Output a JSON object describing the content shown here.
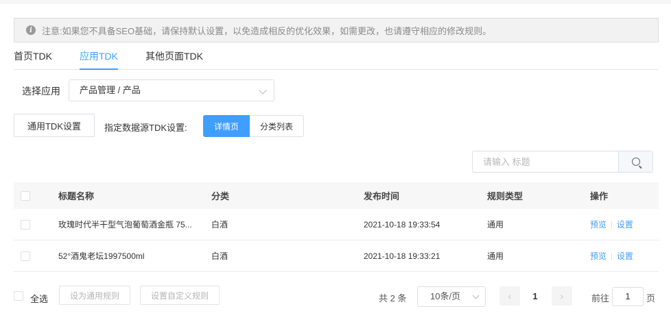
{
  "notice": {
    "text": "注意:如果您不具备SEO基础，请保持默认设置，以免造成相反的优化效果，如需更改，也请遵守相应的修改规则。"
  },
  "tabs": [
    {
      "label": "首页TDK",
      "active": false
    },
    {
      "label": "应用TDK",
      "active": true
    },
    {
      "label": "其他页面TDK",
      "active": false
    }
  ],
  "app_select": {
    "label": "选择应用",
    "value": "产品管理 / 产品"
  },
  "toolbar": {
    "general_btn": "通用TDK设置",
    "source_label": "指定数据源TDK设置:",
    "seg_detail": "详情页",
    "seg_category": "分类列表"
  },
  "search": {
    "placeholder": "请输入 标题"
  },
  "table": {
    "headers": {
      "title": "标题名称",
      "category": "分类",
      "time": "发布时间",
      "rule": "规则类型",
      "action": "操作"
    },
    "rows": [
      {
        "title": "玫瑰时代半干型气泡葡萄酒金瓶 75...",
        "category": "白酒",
        "time": "2021-10-18 19:33:54",
        "rule": "通用",
        "preview": "预览",
        "settings": "设置"
      },
      {
        "title": "52°酒鬼老坛1997500ml",
        "category": "白酒",
        "time": "2021-10-18 19:33:21",
        "rule": "通用",
        "preview": "预览",
        "settings": "设置"
      }
    ]
  },
  "footer": {
    "select_all": "全选",
    "set_general": "设为通用规则",
    "set_custom": "设置自定义规则",
    "total": "共 2 条",
    "page_size": "10条/页",
    "current_page": "1",
    "goto_label": "前往",
    "goto_value": "1",
    "page_unit": "页"
  },
  "colors": {
    "accent": "#409eff"
  }
}
